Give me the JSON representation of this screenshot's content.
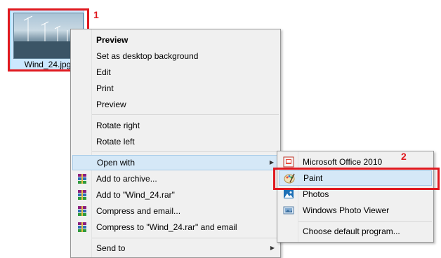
{
  "file": {
    "name": "Wind_24.jpg"
  },
  "annotations": {
    "step1": "1",
    "step2": "2"
  },
  "context_menu": {
    "preview_bold": "Preview",
    "set_desktop": "Set as desktop background",
    "edit": "Edit",
    "print": "Print",
    "preview": "Preview",
    "rotate_right": "Rotate right",
    "rotate_left": "Rotate left",
    "open_with": "Open with",
    "add_archive": "Add to archive...",
    "add_rar": "Add to \"Wind_24.rar\"",
    "compress_email": "Compress and email...",
    "compress_rar_email": "Compress to \"Wind_24.rar\" and email",
    "send_to": "Send to"
  },
  "submenu": {
    "office": "Microsoft Office 2010",
    "paint": "Paint",
    "photos": "Photos",
    "photo_viewer": "Windows Photo Viewer",
    "choose_default": "Choose default program..."
  },
  "colors": {
    "annotation_red": "#e0191f",
    "highlight": "#d5e8f7"
  }
}
